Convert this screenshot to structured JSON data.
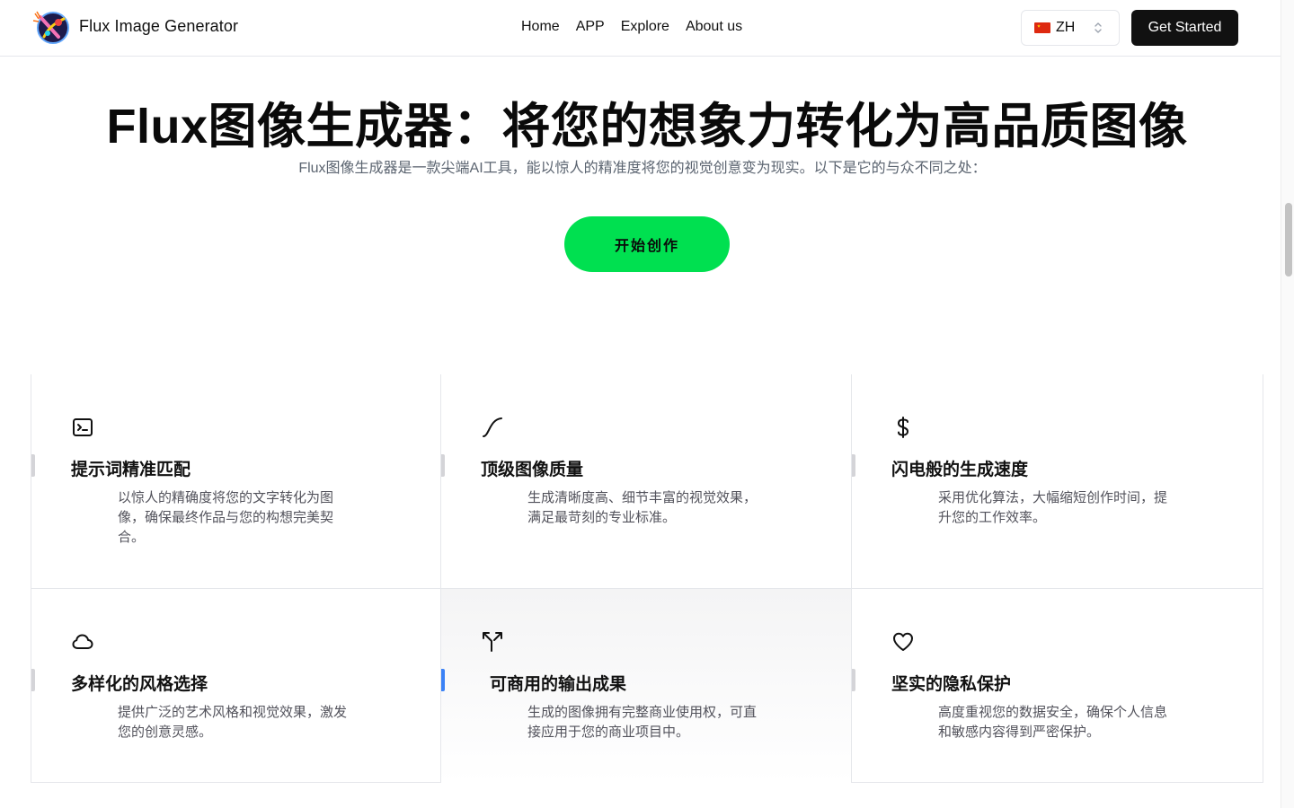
{
  "header": {
    "brand": "Flux Image Generator",
    "nav": [
      {
        "label": "Home"
      },
      {
        "label": "APP"
      },
      {
        "label": "Explore"
      },
      {
        "label": "About us"
      }
    ],
    "language": {
      "code": "ZH",
      "flag_icon": "china-flag-icon"
    },
    "get_started_label": "Get Started"
  },
  "hero": {
    "title": "Flux图像生成器：将您的想象力转化为高品质图像",
    "subtitle": "Flux图像生成器是一款尖端AI工具，能以惊人的精准度将您的视觉创意变为现实。以下是它的与众不同之处：",
    "cta_label": "开始创作"
  },
  "features": [
    {
      "icon": "terminal-icon",
      "title": "提示词精准匹配",
      "desc": "以惊人的精确度将您的文字转化为图像，确保最终作品与您的构想完美契合。"
    },
    {
      "icon": "curve-icon",
      "title": "顶级图像质量",
      "desc": "生成清晰度高、细节丰富的视觉效果，满足最苛刻的专业标准。"
    },
    {
      "icon": "dollar-icon",
      "title": "闪电般的生成速度",
      "desc": "采用优化算法，大幅缩短创作时间，提升您的工作效率。"
    },
    {
      "icon": "cloud-icon",
      "title": "多样化的风格选择",
      "desc": "提供广泛的艺术风格和视觉效果，激发您的创意灵感。"
    },
    {
      "icon": "route-icon",
      "title": "可商用的输出成果",
      "desc": "生成的图像拥有完整商业使用权，可直接应用于您的商业项目中。"
    },
    {
      "icon": "heart-icon",
      "title": "坚实的隐私保护",
      "desc": "高度重视您的数据安全，确保个人信息和敏感内容得到严密保护。"
    }
  ],
  "colors": {
    "primary_cta": "#00e050",
    "dark_button": "#111111",
    "accent_active": "#3b82f6"
  }
}
